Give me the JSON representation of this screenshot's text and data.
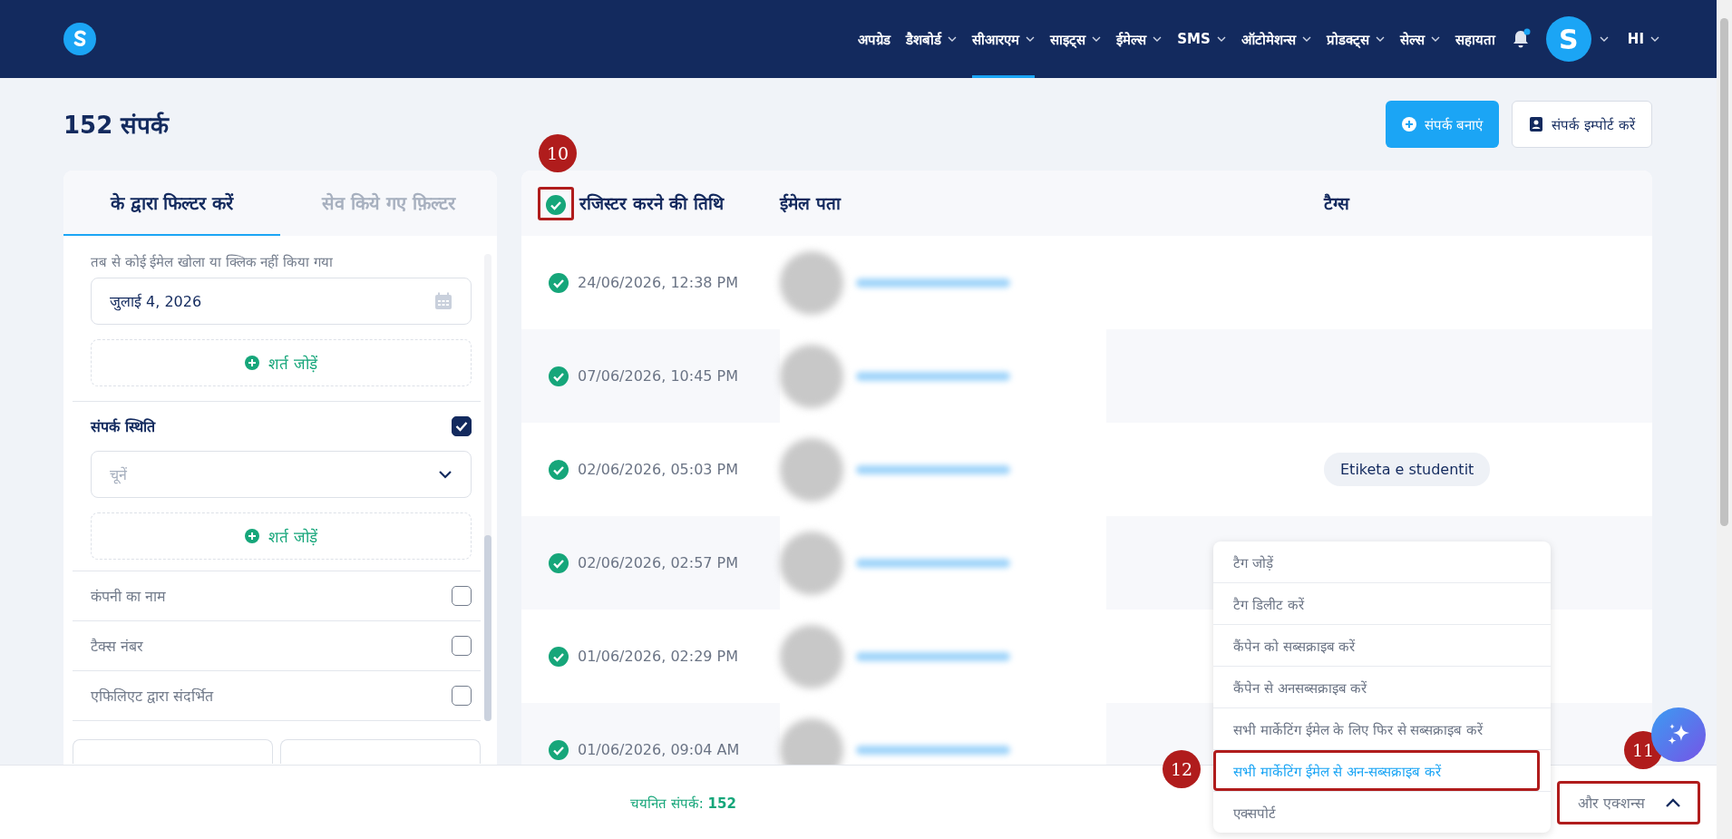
{
  "nav": {
    "items": [
      {
        "label": "अपग्रेड",
        "dropdown": false,
        "selected": false
      },
      {
        "label": "डैशबोर्ड",
        "dropdown": true,
        "selected": false
      },
      {
        "label": "सीआरएम",
        "dropdown": true,
        "selected": true
      },
      {
        "label": "साइट्स",
        "dropdown": true,
        "selected": false
      },
      {
        "label": "ईमेल्स",
        "dropdown": true,
        "selected": false
      },
      {
        "label": "SMS",
        "dropdown": true,
        "selected": false
      },
      {
        "label": "ऑटोमेशन्स",
        "dropdown": true,
        "selected": false
      },
      {
        "label": "प्रोडक्ट्स",
        "dropdown": true,
        "selected": false
      },
      {
        "label": "सेल्स",
        "dropdown": true,
        "selected": false
      },
      {
        "label": "सहायता",
        "dropdown": false,
        "selected": false
      }
    ],
    "notification_dot": true,
    "avatar_letter": "S",
    "language": "HI"
  },
  "page": {
    "title": "152 संपर्क",
    "buttons": [
      {
        "label": "संपर्क बनाएं",
        "kind": "primary"
      },
      {
        "label": "संपर्क इम्पोर्ट करें",
        "kind": "secondary"
      }
    ]
  },
  "filter_panel": {
    "tabs": [
      {
        "label": "के द्वारा फिल्टर करें",
        "selected": true
      },
      {
        "label": "सेव किये गए फ़िल्टर",
        "selected": false
      }
    ],
    "email_filter": {
      "label": "तब से कोई ईमेल खोला या क्लिक नहीं किया गया",
      "date": "जुलाई 4, 2026",
      "add_condition": "शर्त जोड़ें"
    },
    "fields": [
      {
        "label": "संपर्क स्थिति",
        "checked": true,
        "select_placeholder": "चूनें",
        "add_condition": "शर्त जोड़ें"
      },
      {
        "label": "कंपनी का नाम",
        "checked": false
      },
      {
        "label": "टैक्स नंबर",
        "checked": false
      },
      {
        "label": "एफिलिएट द्वारा संदर्भित",
        "checked": false
      }
    ]
  },
  "table": {
    "header_checked": true,
    "header_annotation": "10",
    "columns": [
      "रजिस्टर करने की तिथि",
      "ईमेल पता",
      "टैग्स"
    ],
    "rows": [
      {
        "date": "24/06/2026, 12:38 PM",
        "selected": true
      },
      {
        "date": "07/06/2026, 10:45 PM",
        "selected": true
      },
      {
        "date": "02/06/2026, 05:03 PM",
        "selected": true,
        "tag": "Etiketa e studentit"
      },
      {
        "date": "02/06/2026, 02:57 PM",
        "selected": true
      },
      {
        "date": "01/06/2026, 02:29 PM",
        "selected": true
      },
      {
        "date": "01/06/2026, 09:04 AM",
        "selected": true
      }
    ]
  },
  "actions_menu": {
    "items": [
      {
        "label": "टैग जोड़ें",
        "selected": false
      },
      {
        "label": "टैग डिलीट करें",
        "selected": false
      },
      {
        "label": "कैंपेन को सब्सक्राइब करें",
        "selected": false
      },
      {
        "label": "कैंपेन से अनसब्सक्राइब करें",
        "selected": false
      },
      {
        "label": "सभी मार्केटिंग ईमेल के लिए फिर से सब्सक्राइब करें",
        "selected": false
      },
      {
        "label": "सभी मार्केटिंग ईमेल से अन-सब्सक्राइब करें",
        "selected": true,
        "annotation": "12"
      },
      {
        "label": "एक्सपोर्ट",
        "selected": false
      }
    ]
  },
  "bottom_bar": {
    "selected_text": "चयनित संपर्क: **152**",
    "more_actions": {
      "label": "और एक्शन्स",
      "expanded": true,
      "annotation": "11"
    }
  }
}
